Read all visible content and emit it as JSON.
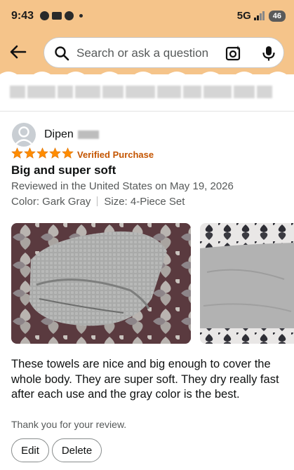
{
  "status_bar": {
    "time": "9:43",
    "network": "5G",
    "battery": "46"
  },
  "search": {
    "placeholder": "Search or ask a question"
  },
  "review": {
    "reviewer_name": "Dipen",
    "rating": 5,
    "max_rating": 5,
    "verified_label": "Verified Purchase",
    "title": "Big and super soft",
    "meta": "Reviewed in the United States on May 19, 2026",
    "color": "Color: Gark Gray",
    "size": "Size: 4-Piece Set",
    "body": "These towels are nice and big enough to cover the whole body. They are super soft. They dry really fast after each use and the gray color is the best.",
    "thanks": "Thank you for your review."
  },
  "actions": {
    "edit_label": "Edit",
    "delete_label": "Delete"
  },
  "colors": {
    "header_bg": "#f5c48a",
    "star": "#ff8c00",
    "verified": "#c45500",
    "muted_text": "#565959"
  },
  "icons": [
    "back-arrow-icon",
    "search-icon",
    "camera-icon",
    "mic-icon",
    "avatar-icon",
    "star-icon"
  ]
}
